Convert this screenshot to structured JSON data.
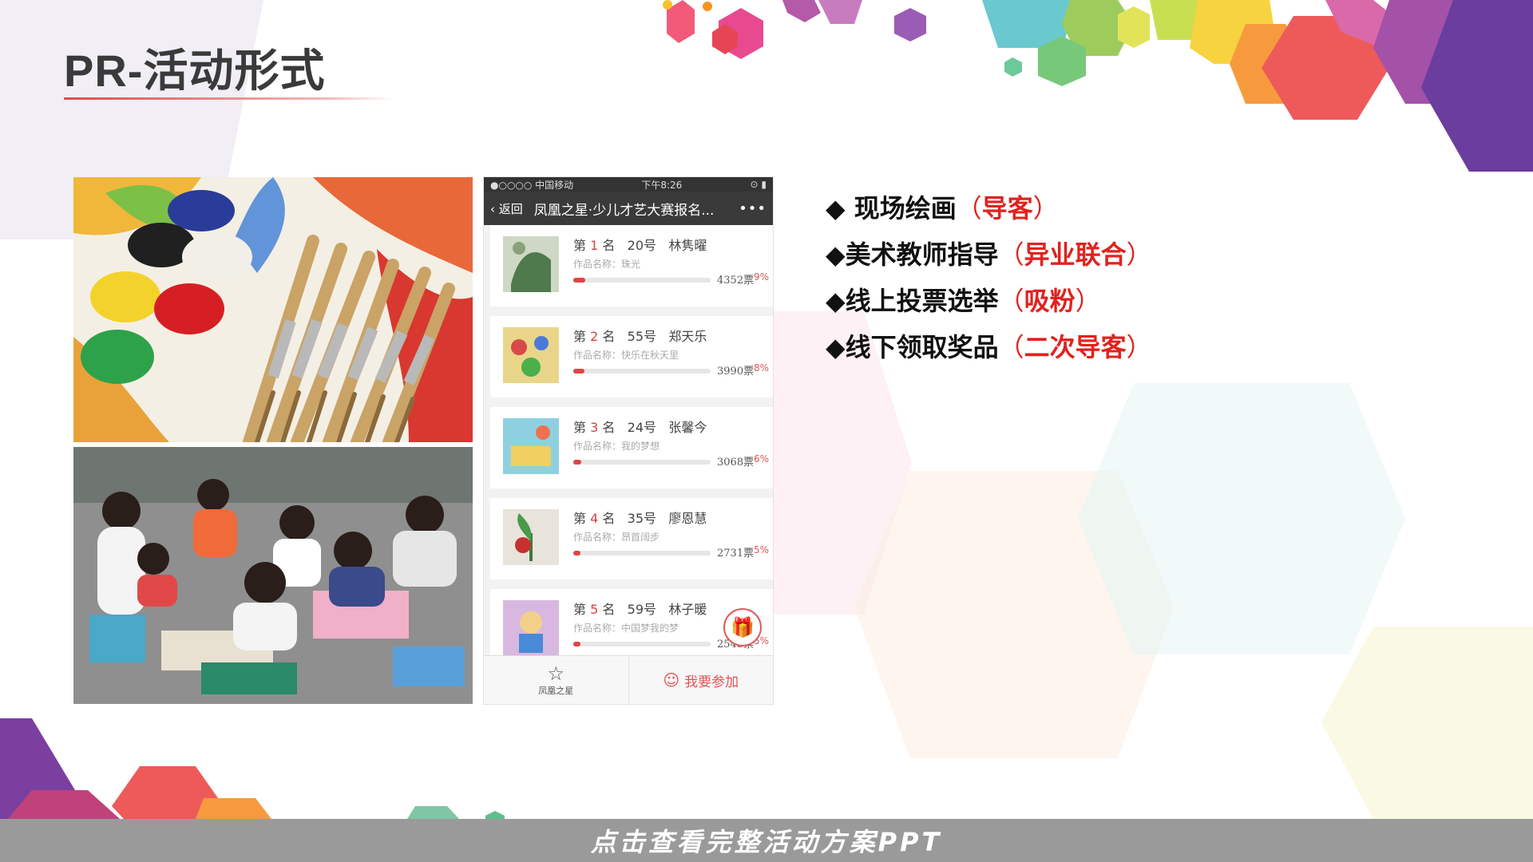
{
  "title": "PR-活动形式",
  "phone": {
    "status_left": "●○○○○ 中国移动",
    "status_time": "下午8:26",
    "status_right": "⊙ ▮",
    "back_label": "返回",
    "nav_title": "凤凰之星·少儿才艺大赛报名...",
    "more": "•••",
    "entries": [
      {
        "rank_prefix": "第",
        "rank": "1",
        "rank_suffix": "名",
        "no": "20号",
        "name": "林隽曜",
        "work": "作品名称：珠光",
        "votes": "4352票",
        "pct": "9%",
        "progress": 0.09
      },
      {
        "rank_prefix": "第",
        "rank": "2",
        "rank_suffix": "名",
        "no": "55号",
        "name": "郑天乐",
        "work": "作品名称：快乐在秋天里",
        "votes": "3990票",
        "pct": "8%",
        "progress": 0.08
      },
      {
        "rank_prefix": "第",
        "rank": "3",
        "rank_suffix": "名",
        "no": "24号",
        "name": "张馨今",
        "work": "作品名称：我的梦想",
        "votes": "3068票",
        "pct": "6%",
        "progress": 0.06
      },
      {
        "rank_prefix": "第",
        "rank": "4",
        "rank_suffix": "名",
        "no": "35号",
        "name": "廖恩慧",
        "work": "作品名称：昂首阔步",
        "votes": "2731票",
        "pct": "5%",
        "progress": 0.05
      },
      {
        "rank_prefix": "第",
        "rank": "5",
        "rank_suffix": "名",
        "no": "59号",
        "name": "林子暖",
        "work": "作品名称：中国梦我的梦",
        "votes": "2545票",
        "pct": "5%",
        "progress": 0.05
      }
    ],
    "tab_home_label": "凤凰之星",
    "tab_join_label": "我要参加"
  },
  "bullets": [
    {
      "marker": "◆",
      "text": " 现场绘画",
      "open": "（",
      "hl": "导客",
      "close": "）"
    },
    {
      "marker": "◆",
      "text": "美术教师指导",
      "open": "（",
      "hl": "异业联合",
      "close": "）"
    },
    {
      "marker": "◆",
      "text": "线上投票选举",
      "open": "（",
      "hl": "吸粉",
      "close": "）"
    },
    {
      "marker": "◆",
      "text": "线下领取奖品",
      "open": "（",
      "hl": "二次导客",
      "close": "）"
    }
  ],
  "footer": "点击查看完整活动方案PPT",
  "colors": {
    "accent_red": "#e0221e",
    "footer_bg": "#9a9a9a",
    "phone_nav": "#3a3a3a"
  }
}
